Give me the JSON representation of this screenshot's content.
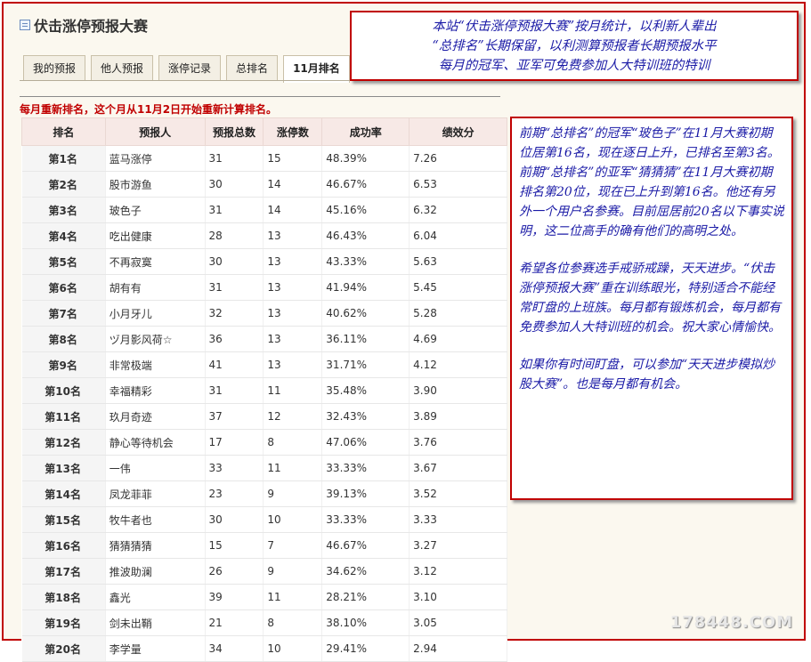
{
  "page": {
    "title": "伏击涨停预报大赛",
    "notice": "每月重新排名，这个月从11月2日开始重新计算排名。",
    "watermark": "178448.COM"
  },
  "tabs": [
    {
      "label": "我的预报"
    },
    {
      "label": "他人预报"
    },
    {
      "label": "涨停记录"
    },
    {
      "label": "总排名"
    },
    {
      "label": "11月排名",
      "active": true
    }
  ],
  "table": {
    "headers": [
      "排名",
      "预报人",
      "预报总数",
      "涨停数",
      "成功率",
      "绩效分"
    ],
    "rows": [
      [
        "第1名",
        "蓝马涨停",
        "31",
        "15",
        "48.39%",
        "7.26"
      ],
      [
        "第2名",
        "股市游鱼",
        "30",
        "14",
        "46.67%",
        "6.53"
      ],
      [
        "第3名",
        "玻色子",
        "31",
        "14",
        "45.16%",
        "6.32"
      ],
      [
        "第4名",
        "吃出健康",
        "28",
        "13",
        "46.43%",
        "6.04"
      ],
      [
        "第5名",
        "不再寂寞",
        "30",
        "13",
        "43.33%",
        "5.63"
      ],
      [
        "第6名",
        "胡有有",
        "31",
        "13",
        "41.94%",
        "5.45"
      ],
      [
        "第7名",
        "小月牙儿",
        "32",
        "13",
        "40.62%",
        "5.28"
      ],
      [
        "第8名",
        "ヅ月影风荷☆",
        "36",
        "13",
        "36.11%",
        "4.69"
      ],
      [
        "第9名",
        "非常极端",
        "41",
        "13",
        "31.71%",
        "4.12"
      ],
      [
        "第10名",
        "幸福精彩",
        "31",
        "11",
        "35.48%",
        "3.90"
      ],
      [
        "第11名",
        "玖月奇迹",
        "37",
        "12",
        "32.43%",
        "3.89"
      ],
      [
        "第12名",
        "静心等待机会",
        "17",
        "8",
        "47.06%",
        "3.76"
      ],
      [
        "第13名",
        "一伟",
        "33",
        "11",
        "33.33%",
        "3.67"
      ],
      [
        "第14名",
        "凤龙菲菲",
        "23",
        "9",
        "39.13%",
        "3.52"
      ],
      [
        "第15名",
        "牧牛者也",
        "30",
        "10",
        "33.33%",
        "3.33"
      ],
      [
        "第16名",
        "猜猜猜猜",
        "15",
        "7",
        "46.67%",
        "3.27"
      ],
      [
        "第17名",
        "推波助澜",
        "26",
        "9",
        "34.62%",
        "3.12"
      ],
      [
        "第18名",
        "鑫光",
        "39",
        "11",
        "28.21%",
        "3.10"
      ],
      [
        "第19名",
        "剑未出鞘",
        "21",
        "8",
        "38.10%",
        "3.05"
      ],
      [
        "第20名",
        "李学量",
        "34",
        "10",
        "29.41%",
        "2.94"
      ]
    ]
  },
  "notes": {
    "top": "本站“伏击涨停预报大赛”按月统计，以利新人辈出\n“总排名”长期保留，以利测算预报者长期预报水平\n每月的冠军、亚军可免费参加人大特训班的特训",
    "side_p1": "前期“总排名”的冠军“玻色子”在11月大赛初期位居第16名，现在逐日上升，已排名至第3名。\n前期“总排名”的亚军“猜猜猜”在11月大赛初期排名第20位，现在已上升到第16名。他还有另外一个用户名参赛。目前屈居前20名以下事实说明，这二位高手的确有他们的高明之处。",
    "side_p2": "希望各位参赛选手戒骄戒躁，天天进步。“伏击涨停预报大赛”重在训练眼光，特别适合不能经常盯盘的上班族。每月都有锻炼机会，每月都有免费参加人大特训班的机会。祝大家心情愉快。",
    "side_p3": "如果你有时间盯盘，可以参加“天天进步模拟炒股大赛”。也是每月都有机会。"
  }
}
